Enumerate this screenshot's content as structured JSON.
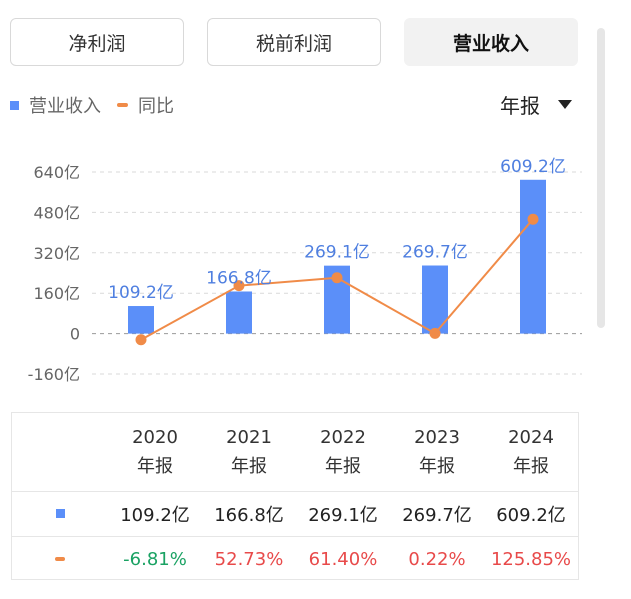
{
  "tabs": [
    "净利润",
    "税前利润",
    "营业收入"
  ],
  "active_tab": 2,
  "legend": {
    "bar_label": "营业收入",
    "line_label": "同比"
  },
  "period_selector": "年报",
  "chart_data": {
    "type": "bar+line",
    "categories": [
      "2020",
      "2021",
      "2022",
      "2023",
      "2024"
    ],
    "bar_series": {
      "name": "营业收入",
      "values": [
        109.2,
        166.8,
        269.1,
        269.7,
        609.2
      ],
      "labels": [
        "109.2亿",
        "166.8亿",
        "269.1亿",
        "269.7亿",
        "609.2亿"
      ],
      "color": "#5b8ff9"
    },
    "line_series": {
      "name": "同比",
      "values": [
        -6.81,
        52.73,
        61.4,
        0.22,
        125.85
      ],
      "color": "#f08b48"
    },
    "yaxis": {
      "ticks": [
        "640亿",
        "480亿",
        "320亿",
        "160亿",
        "0",
        "-160亿"
      ],
      "range": [
        -160,
        640
      ]
    },
    "grid": true,
    "legend_position": "top-left"
  },
  "table": {
    "years": [
      "2020",
      "2021",
      "2022",
      "2023",
      "2024"
    ],
    "period_label": "年报",
    "revenue": [
      "109.2亿",
      "166.8亿",
      "269.1亿",
      "269.7亿",
      "609.2亿"
    ],
    "yoy": [
      "-6.81%",
      "52.73%",
      "61.40%",
      "0.22%",
      "125.85%"
    ]
  },
  "colors": {
    "bar": "#5b8ff9",
    "line": "#f08b48",
    "positive": "#e84a4a",
    "negative": "#1aa263"
  }
}
